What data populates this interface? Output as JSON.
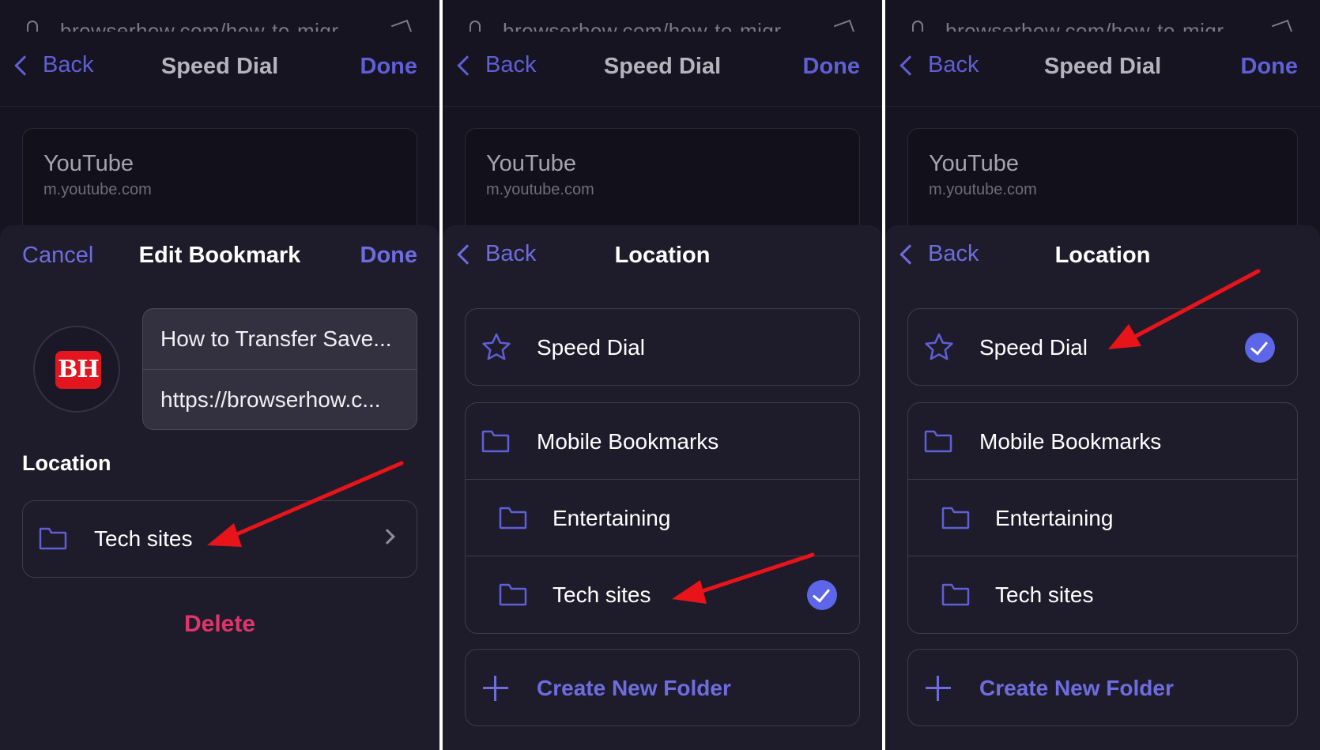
{
  "colors": {
    "background": "#161421",
    "sheet": "#1e1c2b",
    "accent": "#5f5fd6",
    "delete": "#e0356a",
    "check": "#5d66e8",
    "annotation_arrow": "#e8141a"
  },
  "url": "browserhow.com/how-to-migr",
  "top_nav": {
    "back": "Back",
    "title": "Speed Dial",
    "done": "Done"
  },
  "bookmark_card": {
    "title": "YouTube",
    "url": "m.youtube.com"
  },
  "panel1": {
    "sheet": {
      "cancel": "Cancel",
      "title": "Edit Bookmark",
      "done": "Done"
    },
    "logo_text": "BH",
    "fields": {
      "title": "How to Transfer Save...",
      "url": "https://browserhow.c..."
    },
    "location_label": "Location",
    "location_value": "Tech sites",
    "delete": "Delete"
  },
  "location_sheet": {
    "back": "Back",
    "title": "Location",
    "speed_dial": "Speed Dial",
    "folders": [
      "Mobile Bookmarks",
      "Entertaining",
      "Tech sites"
    ],
    "create_folder": "Create New Folder"
  },
  "panel2": {
    "selected": "Tech sites"
  },
  "panel3": {
    "selected": "Speed Dial"
  }
}
